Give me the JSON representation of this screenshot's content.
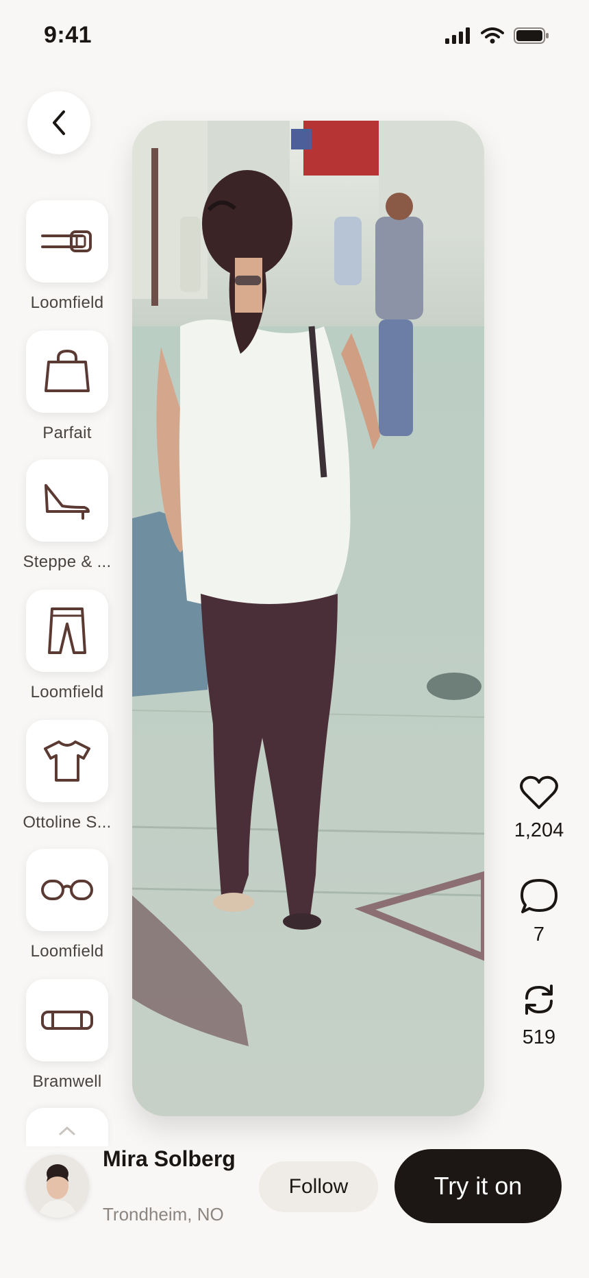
{
  "status": {
    "time": "9:41",
    "icons": [
      "cellular-signal-icon",
      "wifi-icon",
      "battery-icon"
    ]
  },
  "nav": {
    "back_icon": "chevron-left-icon"
  },
  "items": [
    {
      "icon": "belt-icon",
      "label": "Loomfield"
    },
    {
      "icon": "handbag-icon",
      "label": "Parfait"
    },
    {
      "icon": "shoe-icon",
      "label": "Steppe & ..."
    },
    {
      "icon": "pants-icon",
      "label": "Loomfield"
    },
    {
      "icon": "tshirt-icon",
      "label": "Ottoline S..."
    },
    {
      "icon": "glasses-icon",
      "label": "Loomfield"
    },
    {
      "icon": "bracelet-icon",
      "label": "Bramwell"
    }
  ],
  "actions": {
    "likes": "1,204",
    "comments": "7",
    "reposts": "519"
  },
  "user": {
    "name": "Mira Solberg",
    "location": "Trondheim, NO",
    "follow_label": "Follow",
    "try_label": "Try it on"
  },
  "colors": {
    "accent_dark": "#1c1714",
    "icon_brown": "#5a3a32",
    "background": "#f8f7f5"
  }
}
